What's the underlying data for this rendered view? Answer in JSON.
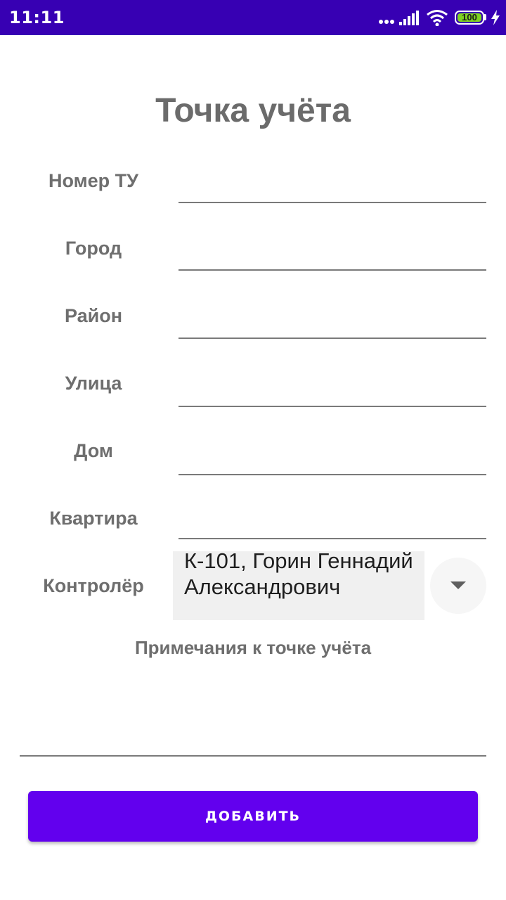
{
  "status_bar": {
    "time": "11:11",
    "battery": "100",
    "background_color": "#3700b3",
    "icons": [
      "more-dots-icon",
      "signal-icon",
      "wifi-icon",
      "battery-icon",
      "charging-icon"
    ]
  },
  "title": "Точка учёта",
  "fields": [
    {
      "label": "Номер ТУ",
      "value": ""
    },
    {
      "label": "Город",
      "value": ""
    },
    {
      "label": "Район",
      "value": ""
    },
    {
      "label": "Улица",
      "value": ""
    },
    {
      "label": "Дом",
      "value": ""
    },
    {
      "label": "Квартира",
      "value": ""
    }
  ],
  "controller": {
    "label": "Контролёр",
    "selected": "К-101, Горин Геннадий Александрович",
    "dropdown_icon": "dropdown-arrow-icon"
  },
  "notes": {
    "label": "Примечания к точке учёта",
    "value": ""
  },
  "add_button": {
    "label": "ДОБАВИТЬ",
    "color": "#6200ee"
  }
}
